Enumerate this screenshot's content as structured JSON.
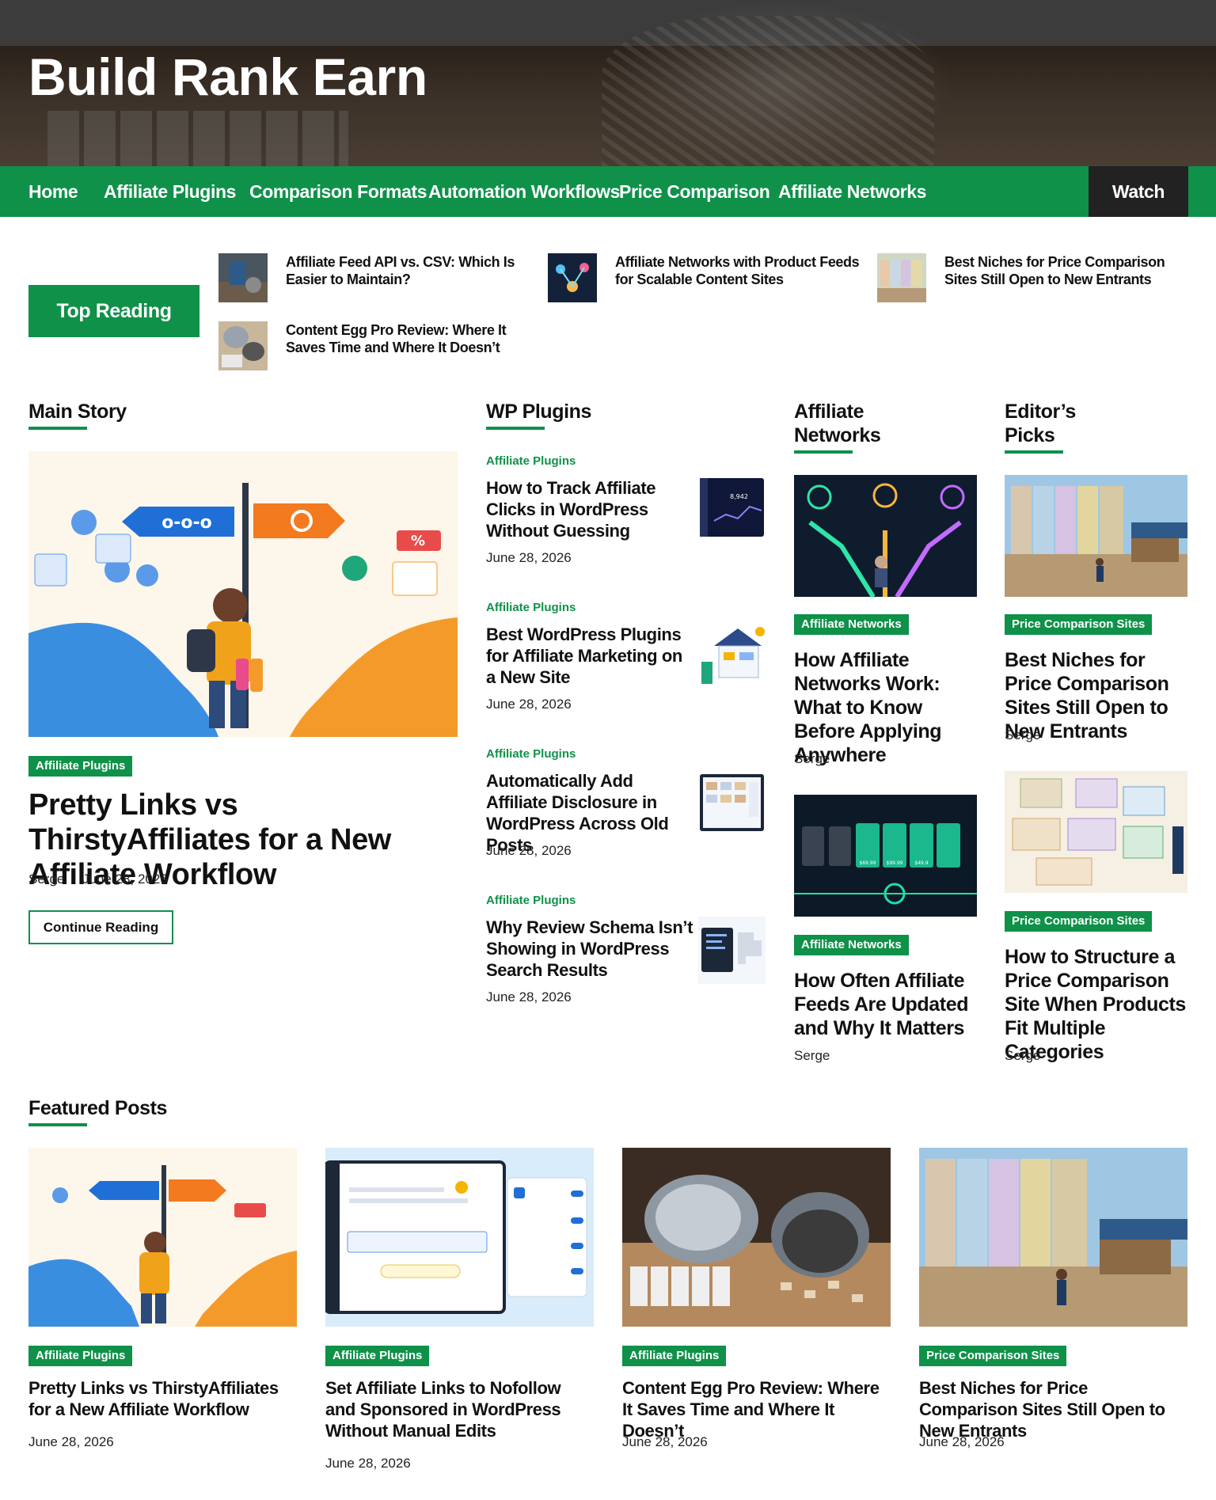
{
  "site": {
    "title": "Build Rank Earn"
  },
  "nav": {
    "items": [
      "Home",
      "Affiliate Plugins",
      "Comparison Formats",
      "Automation Workflows",
      "Price Comparison",
      "Affiliate Networks"
    ],
    "watch": "Watch"
  },
  "top_reading": {
    "label": "Top Reading",
    "items": [
      "Affiliate Feed API vs. CSV: Which Is Easier to Maintain?",
      "Affiliate Networks with Product Feeds for Scalable Content Sites",
      "Best Niches for Price Comparison Sites Still Open to New Entrants",
      "Content Egg Pro Review: Where It Saves Time and Where It Doesn’t"
    ]
  },
  "main_story": {
    "heading": "Main Story",
    "category": "Affiliate Plugins",
    "title": "Pretty Links vs ThirstyAffiliates for a New Affiliate Workflow",
    "author": "Serge",
    "date": "June 28, 2026",
    "button": "Continue Reading"
  },
  "wp_plugins": {
    "heading": "WP Plugins",
    "posts": [
      {
        "category": "Affiliate Plugins",
        "title": "How to Track Affiliate Clicks in WordPress Without Guessing",
        "date": "June 28, 2026"
      },
      {
        "category": "Affiliate Plugins",
        "title": "Best WordPress Plugins for Affiliate Marketing on a New Site",
        "date": "June 28, 2026"
      },
      {
        "category": "Affiliate Plugins",
        "title": "Automatically Add Affiliate Disclosure in WordPress Across Old Posts",
        "date": "June 28, 2026"
      },
      {
        "category": "Affiliate Plugins",
        "title": "Why Review Schema Isn’t Showing in WordPress Search Results",
        "date": "June 28, 2026"
      }
    ]
  },
  "affiliate_networks": {
    "heading_line1": "Affiliate",
    "heading_line2": "Networks",
    "posts": [
      {
        "category": "Affiliate Networks",
        "title": "How Affiliate Networks Work: What to Know Before Applying Anywhere",
        "author": "Serge"
      },
      {
        "category": "Affiliate Networks",
        "title": "How Often Affiliate Feeds Are Updated and Why It Matters",
        "author": "Serge"
      }
    ]
  },
  "editors_picks": {
    "heading_line1": "Editor’s",
    "heading_line2": "Picks",
    "posts": [
      {
        "category": "Price Comparison Sites",
        "title": "Best Niches for Price Comparison Sites Still Open to New Entrants",
        "author": "Serge"
      },
      {
        "category": "Price Comparison Sites",
        "title": "How to Structure a Price Comparison Site When Products Fit Multiple Categories",
        "author": "Serge"
      }
    ]
  },
  "featured": {
    "heading": "Featured Posts",
    "posts": [
      {
        "category": "Affiliate Plugins",
        "title": "Pretty Links vs ThirstyAffiliates for a New Affiliate Workflow",
        "date": "June 28, 2026"
      },
      {
        "category": "Affiliate Plugins",
        "title": "Set Affiliate Links to Nofollow and Sponsored in WordPress Without Manual Edits",
        "date": "June 28, 2026"
      },
      {
        "category": "Affiliate Plugins",
        "title": "Content Egg Pro Review: Where It Saves Time and Where It Doesn’t",
        "date": "June 28, 2026"
      },
      {
        "category": "Price Comparison Sites",
        "title": "Best Niches for Price Comparison Sites Still Open to New Entrants",
        "date": "June 28, 2026"
      }
    ]
  },
  "image_text": {
    "main_story_signpost": "o-o-o",
    "discount": "%",
    "wp_click_stat": "8,942",
    "price_1": "$69.99",
    "price_2": "$99.99",
    "price_3": "$49.9"
  },
  "colors": {
    "accent": "#0f9149",
    "nav_watch": "#222222"
  }
}
